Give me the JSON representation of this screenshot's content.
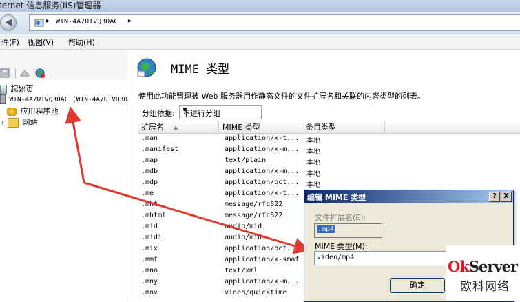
{
  "window": {
    "title": "ternet 信息服务(IIS)管理器"
  },
  "address": {
    "path": "WIN-4A7UTVQ30AC",
    "separator": "▸"
  },
  "menu": {
    "items": [
      "件(F)",
      "视图(V)",
      "帮助(H)"
    ]
  },
  "tree": {
    "items": [
      {
        "label": "起始页",
        "icon": "home-icon"
      },
      {
        "label": "WIN-4A7UTVQ30AC (WIN-4A7UTVQ30AC",
        "icon": "server-icon"
      },
      {
        "label": "应用程序池",
        "icon": "app-pool-icon"
      },
      {
        "label": "网站",
        "icon": "sites-folder-icon"
      }
    ]
  },
  "main": {
    "title": "MIME 类型",
    "description": "使用此功能管理被 Web 服务器用作静态文件的文件扩展名和关联的内容类型的列表。",
    "group_label": "分组依据:",
    "group_value": "不进行分组",
    "columns": [
      "扩展名",
      "MIME 类型",
      "条目类型"
    ],
    "rows": [
      {
        "ext": ".man",
        "mime": "application/x-t...",
        "type": "本地"
      },
      {
        "ext": ".manifest",
        "mime": "application/x-m...",
        "type": "本地"
      },
      {
        "ext": ".map",
        "mime": "text/plain",
        "type": "本地"
      },
      {
        "ext": ".mdb",
        "mime": "application/x-m...",
        "type": "本地"
      },
      {
        "ext": ".mdp",
        "mime": "application/oct...",
        "type": "本地"
      },
      {
        "ext": ".me",
        "mime": "application/x-t...",
        "type": ""
      },
      {
        "ext": ".mht",
        "mime": "message/rfc822",
        "type": ""
      },
      {
        "ext": ".mhtml",
        "mime": "message/rfc822",
        "type": ""
      },
      {
        "ext": ".mid",
        "mime": "audio/mid",
        "type": ""
      },
      {
        "ext": ".midi",
        "mime": "audio/mid",
        "type": ""
      },
      {
        "ext": ".mix",
        "mime": "application/oct...",
        "type": ""
      },
      {
        "ext": ".mmf",
        "mime": "application/x-smaf",
        "type": ""
      },
      {
        "ext": ".mno",
        "mime": "text/xml",
        "type": ""
      },
      {
        "ext": ".mny",
        "mime": "application/x-m...",
        "type": ""
      },
      {
        "ext": ".mov",
        "mime": "video/quicktime",
        "type": ""
      }
    ]
  },
  "dialog": {
    "title": "编辑 MIME 类型",
    "help_label": "?",
    "close_label": "X",
    "ext_label": "文件扩展名(E):",
    "ext_value": ".mp4",
    "mime_label": "MIME 类型(M):",
    "mime_value": "video/mp4",
    "ok_label": "确定"
  },
  "watermark": {
    "brand_ok": "Ok",
    "brand_rest": "Server",
    "cn": "欧科网络"
  },
  "colors": {
    "arrow": "#e03a2f",
    "dialog_title": "#0a246a",
    "selection": "#316ac5"
  }
}
